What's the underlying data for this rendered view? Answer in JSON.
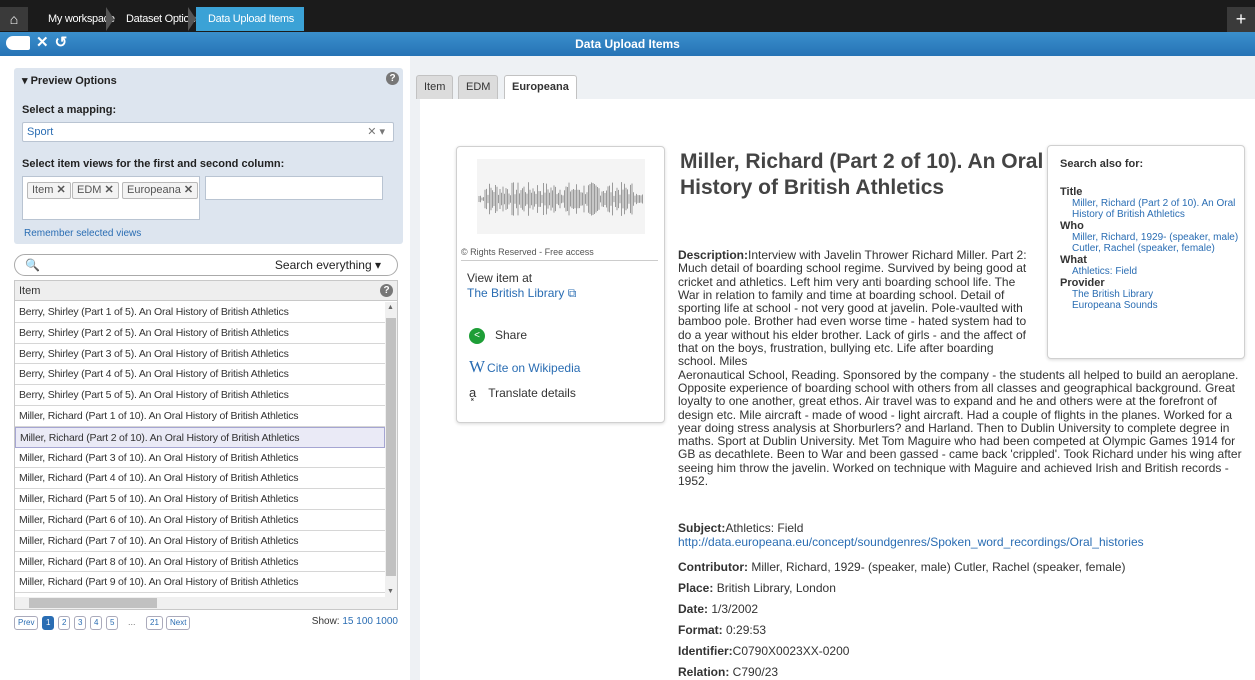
{
  "breadcrumb": {
    "items": [
      "My workspace",
      "Dataset Options",
      "Data Upload Items"
    ]
  },
  "titlebar": {
    "title": "Data Upload Items"
  },
  "preview": {
    "header": "▾ Preview Options",
    "mapping_label": "Select a mapping:",
    "mapping_value": "Sport",
    "views_label": "Select item views for the first and second column:",
    "views": [
      "Item",
      "EDM",
      "Europeana"
    ],
    "remember_link": "Remember selected views"
  },
  "search": {
    "dropdown_label": "Search everything"
  },
  "grid": {
    "column_header": "Item",
    "rows": [
      "Berry, Shirley (Part 1 of 5). An Oral History of British Athletics",
      "Berry, Shirley (Part 2 of 5). An Oral History of British Athletics",
      "Berry, Shirley (Part 3 of 5). An Oral History of British Athletics",
      "Berry, Shirley (Part 4 of 5). An Oral History of British Athletics",
      "Berry, Shirley (Part 5 of 5). An Oral History of British Athletics",
      "Miller, Richard (Part 1 of 10).  An Oral History of British Athletics",
      "Miller, Richard (Part 2 of 10).  An Oral History of British Athletics",
      "Miller, Richard (Part 3 of 10).  An Oral History of British Athletics",
      "Miller, Richard (Part 4 of 10).  An Oral History of British Athletics",
      "Miller, Richard (Part 5 of 10).  An Oral History of British Athletics",
      "Miller, Richard (Part 6 of 10).  An Oral History of British Athletics",
      "Miller, Richard (Part 7 of 10).  An Oral History of British Athletics",
      "Miller, Richard (Part 8 of 10).  An Oral History of British Athletics",
      "Miller, Richard (Part 9 of 10).  An Oral History of British Athletics"
    ],
    "selected_index": 6
  },
  "pager": {
    "prev": "Prev",
    "pages": [
      "1",
      "2",
      "3",
      "4",
      "5"
    ],
    "ellipsis": "...",
    "last": "21",
    "next": "Next",
    "current": "1",
    "show_label": "Show:",
    "show_options": "15 100 1000"
  },
  "tabs": [
    "Item",
    "EDM",
    "Europeana"
  ],
  "active_tab": "Europeana",
  "record": {
    "rights": "Rights Reserved - Free access",
    "view_item_at": "View item at",
    "provider_link": "The British Library",
    "share": "Share",
    "cite": "Cite on Wikipedia",
    "translate": "Translate details",
    "title": "Miller, Richard (Part 2 of 10).  An Oral History of British Athletics",
    "description_label": "Description:",
    "description_narrow": "Interview with Javelin Thrower Richard Miller. Part 2: Much detail of boarding school regime. Survived by being good at cricket and athletics. Left him very anti boarding school life. The War in relation to family and time at boarding school. Detail of sporting life at school - not very good at javelin. Pole-vaulted with bamboo pole. Brother had even worse time - hated system had to do a year without his elder brother. Lack of girls - and the affect of that on the boys, frustration, bullying etc. Life after boarding school. Miles",
    "description_wide": "Aeronautical School, Reading. Sponsored by the company - the students all helped to build an aeroplane. Opposite experience of boarding school with others from all classes and geographical background. Great loyalty to one another, great ethos. Air travel was to expand and he and others were at the forefront of design etc. Mile aircraft - made of wood - light aircraft. Had a couple of flights in the planes. Worked for a year doing stress analysis at Shorburlers? and Harland. Then to Dublin University to complete degree in maths. Sport at Dublin University. Met Tom Maguire who had been competed at Olympic Games 1914 for GB as decathlete.  Been to War and been gassed - came back 'crippled'. Took Richard under his wing after seeing him throw the javelin. Worked on technique with Maguire and achieved Irish and British records - 1952.",
    "subject_label": "Subject:",
    "subject_value": "Athletics: Field",
    "subject_link": "http://data.europeana.eu/concept/soundgenres/Spoken_word_recordings/Oral_histories",
    "contributor_label": "Contributor:",
    "contributor_value": " Miller, Richard, 1929- (speaker, male) Cutler, Rachel (speaker, female)",
    "place_label": "Place:",
    "place_value": " British Library, London",
    "date_label": "Date:",
    "date_value": " 1/3/2002",
    "format_label": "Format:",
    "format_value": " 0:29:53",
    "identifier_label": "Identifier:",
    "identifier_value": "C0790X0023XX-0200",
    "relation_label": "Relation:",
    "relation_value": " C790/23"
  },
  "search_also": {
    "header": "Search also for:",
    "title_label": "Title",
    "title_link": "Miller, Richard (Part 2 of 10).  An Oral History of British Athletics",
    "who_label": "Who",
    "who_links": [
      "Miller, Richard, 1929- (speaker, male)",
      "Cutler, Rachel (speaker, female)"
    ],
    "what_label": "What",
    "what_links": [
      "Athletics: Field"
    ],
    "provider_label": "Provider",
    "provider_links": [
      "The British Library",
      "Europeana Sounds"
    ]
  }
}
